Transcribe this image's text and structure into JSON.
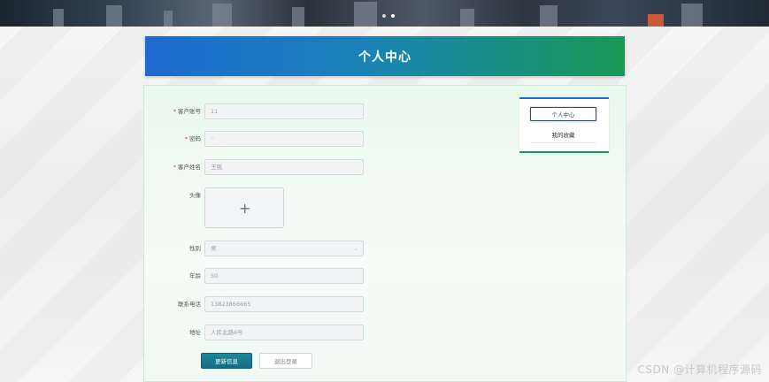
{
  "header": {
    "title": "个人中心"
  },
  "form": {
    "account": {
      "label": "客户账号",
      "value": "11",
      "required": true
    },
    "password": {
      "label": "密码",
      "value": "··",
      "required": true
    },
    "name": {
      "label": "客户姓名",
      "value": "王强",
      "required": true
    },
    "avatar": {
      "label": "头像"
    },
    "gender": {
      "label": "性别",
      "value": "男"
    },
    "age": {
      "label": "年龄",
      "value": "50"
    },
    "phone": {
      "label": "联系电话",
      "value": "13823866665"
    },
    "address": {
      "label": "地址",
      "value": "人民北路6号"
    },
    "required_mark": "*"
  },
  "buttons": {
    "update": "更新信息",
    "logout": "退出登录"
  },
  "sidebar": {
    "items": [
      {
        "label": "个人中心",
        "active": true
      },
      {
        "label": "我的收藏",
        "active": false
      }
    ]
  },
  "watermark": "CSDN @计算机程序源码",
  "icons": {
    "upload": "plus-icon",
    "select": "chevron-down-icon"
  },
  "colors": {
    "header_start": "#1d6ad0",
    "header_end": "#169a55",
    "primary_button": "#146b84",
    "required": "#e4393c"
  }
}
